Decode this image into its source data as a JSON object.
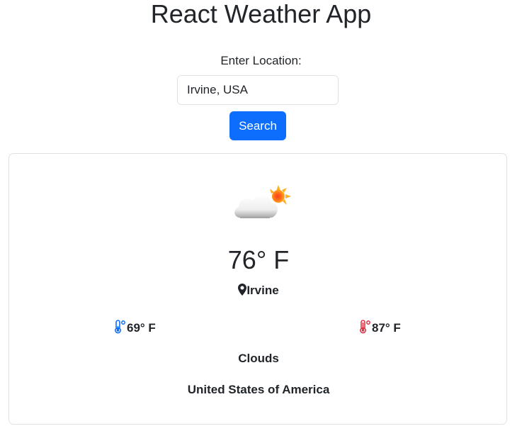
{
  "app": {
    "title": "React Weather App"
  },
  "search": {
    "label": "Enter Location:",
    "value": "Irvine, USA",
    "button_label": "Search"
  },
  "weather": {
    "icon": "partly-cloudy-sun-icon",
    "temperature": "76° F",
    "city": "Irvine",
    "min_temp": "69° F",
    "max_temp": "87° F",
    "condition": "Clouds",
    "country": "United States of America"
  },
  "colors": {
    "accent": "#0d6efd",
    "min_temp_icon": "#0d6efd",
    "max_temp_icon": "#dc3545",
    "text": "#212529",
    "border": "#dee2e6"
  }
}
